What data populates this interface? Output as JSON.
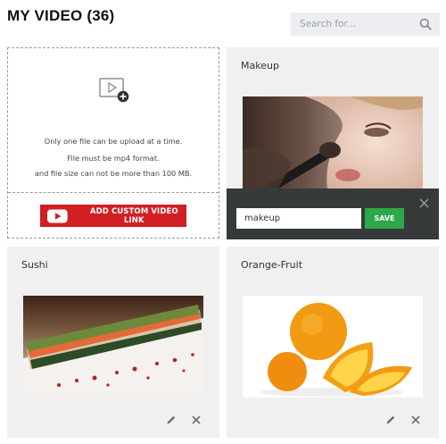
{
  "header": {
    "title": "MY VIDEO (36)"
  },
  "search": {
    "placeholder": "Search for...",
    "icon": "search-icon"
  },
  "upload": {
    "lines": [
      "Only one file can be upload at a time.",
      "File must be mp4 format.",
      "and file size can not be more than 100 MB."
    ],
    "button_label": "ADD CUSTOM VIDEO LINK",
    "button_color": "#d11f24",
    "icon": "video-add-icon"
  },
  "videos": [
    {
      "title": "Makeup"
    },
    {
      "title": "Sushi"
    },
    {
      "title": "Orange-Fruit"
    }
  ],
  "edit_bar": {
    "input_value": "makeup",
    "save_label": "SAVE",
    "save_color": "#2ea84a"
  }
}
